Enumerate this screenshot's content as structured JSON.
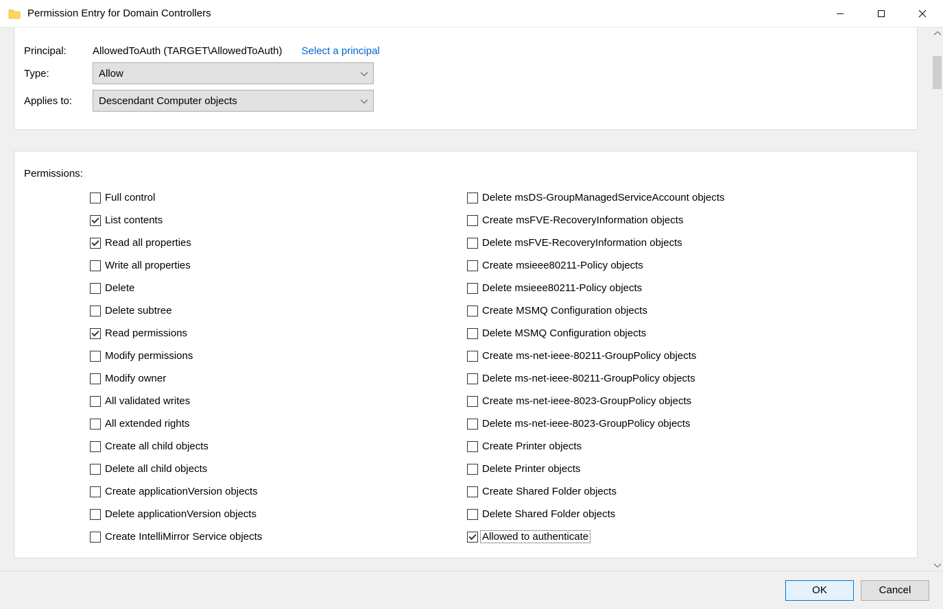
{
  "title": "Permission Entry for Domain Controllers",
  "header": {
    "principal_label": "Principal:",
    "principal_value": "AllowedToAuth (TARGET\\AllowedToAuth)",
    "select_principal": "Select a principal",
    "type_label": "Type:",
    "type_value": "Allow",
    "applies_label": "Applies to:",
    "applies_value": "Descendant Computer objects"
  },
  "permissions_label": "Permissions:",
  "perms_col1": [
    {
      "label": "Full control",
      "checked": false
    },
    {
      "label": "List contents",
      "checked": true
    },
    {
      "label": "Read all properties",
      "checked": true
    },
    {
      "label": "Write all properties",
      "checked": false
    },
    {
      "label": "Delete",
      "checked": false
    },
    {
      "label": "Delete subtree",
      "checked": false
    },
    {
      "label": "Read permissions",
      "checked": true
    },
    {
      "label": "Modify permissions",
      "checked": false
    },
    {
      "label": "Modify owner",
      "checked": false
    },
    {
      "label": "All validated writes",
      "checked": false
    },
    {
      "label": "All extended rights",
      "checked": false
    },
    {
      "label": "Create all child objects",
      "checked": false
    },
    {
      "label": "Delete all child objects",
      "checked": false
    },
    {
      "label": "Create applicationVersion objects",
      "checked": false
    },
    {
      "label": "Delete applicationVersion objects",
      "checked": false
    },
    {
      "label": "Create IntelliMirror Service objects",
      "checked": false
    }
  ],
  "perms_col2": [
    {
      "label": "Delete msDS-GroupManagedServiceAccount objects",
      "checked": false
    },
    {
      "label": "Create msFVE-RecoveryInformation objects",
      "checked": false
    },
    {
      "label": "Delete msFVE-RecoveryInformation objects",
      "checked": false
    },
    {
      "label": "Create msieee80211-Policy objects",
      "checked": false
    },
    {
      "label": "Delete msieee80211-Policy objects",
      "checked": false
    },
    {
      "label": "Create MSMQ Configuration objects",
      "checked": false
    },
    {
      "label": "Delete MSMQ Configuration objects",
      "checked": false
    },
    {
      "label": "Create ms-net-ieee-80211-GroupPolicy objects",
      "checked": false
    },
    {
      "label": "Delete ms-net-ieee-80211-GroupPolicy objects",
      "checked": false
    },
    {
      "label": "Create ms-net-ieee-8023-GroupPolicy objects",
      "checked": false
    },
    {
      "label": "Delete ms-net-ieee-8023-GroupPolicy objects",
      "checked": false
    },
    {
      "label": "Create Printer objects",
      "checked": false
    },
    {
      "label": "Delete Printer objects",
      "checked": false
    },
    {
      "label": "Create Shared Folder objects",
      "checked": false
    },
    {
      "label": "Delete Shared Folder objects",
      "checked": false
    },
    {
      "label": "Allowed to authenticate",
      "checked": true,
      "focused": true
    }
  ],
  "buttons": {
    "ok": "OK",
    "cancel": "Cancel"
  }
}
